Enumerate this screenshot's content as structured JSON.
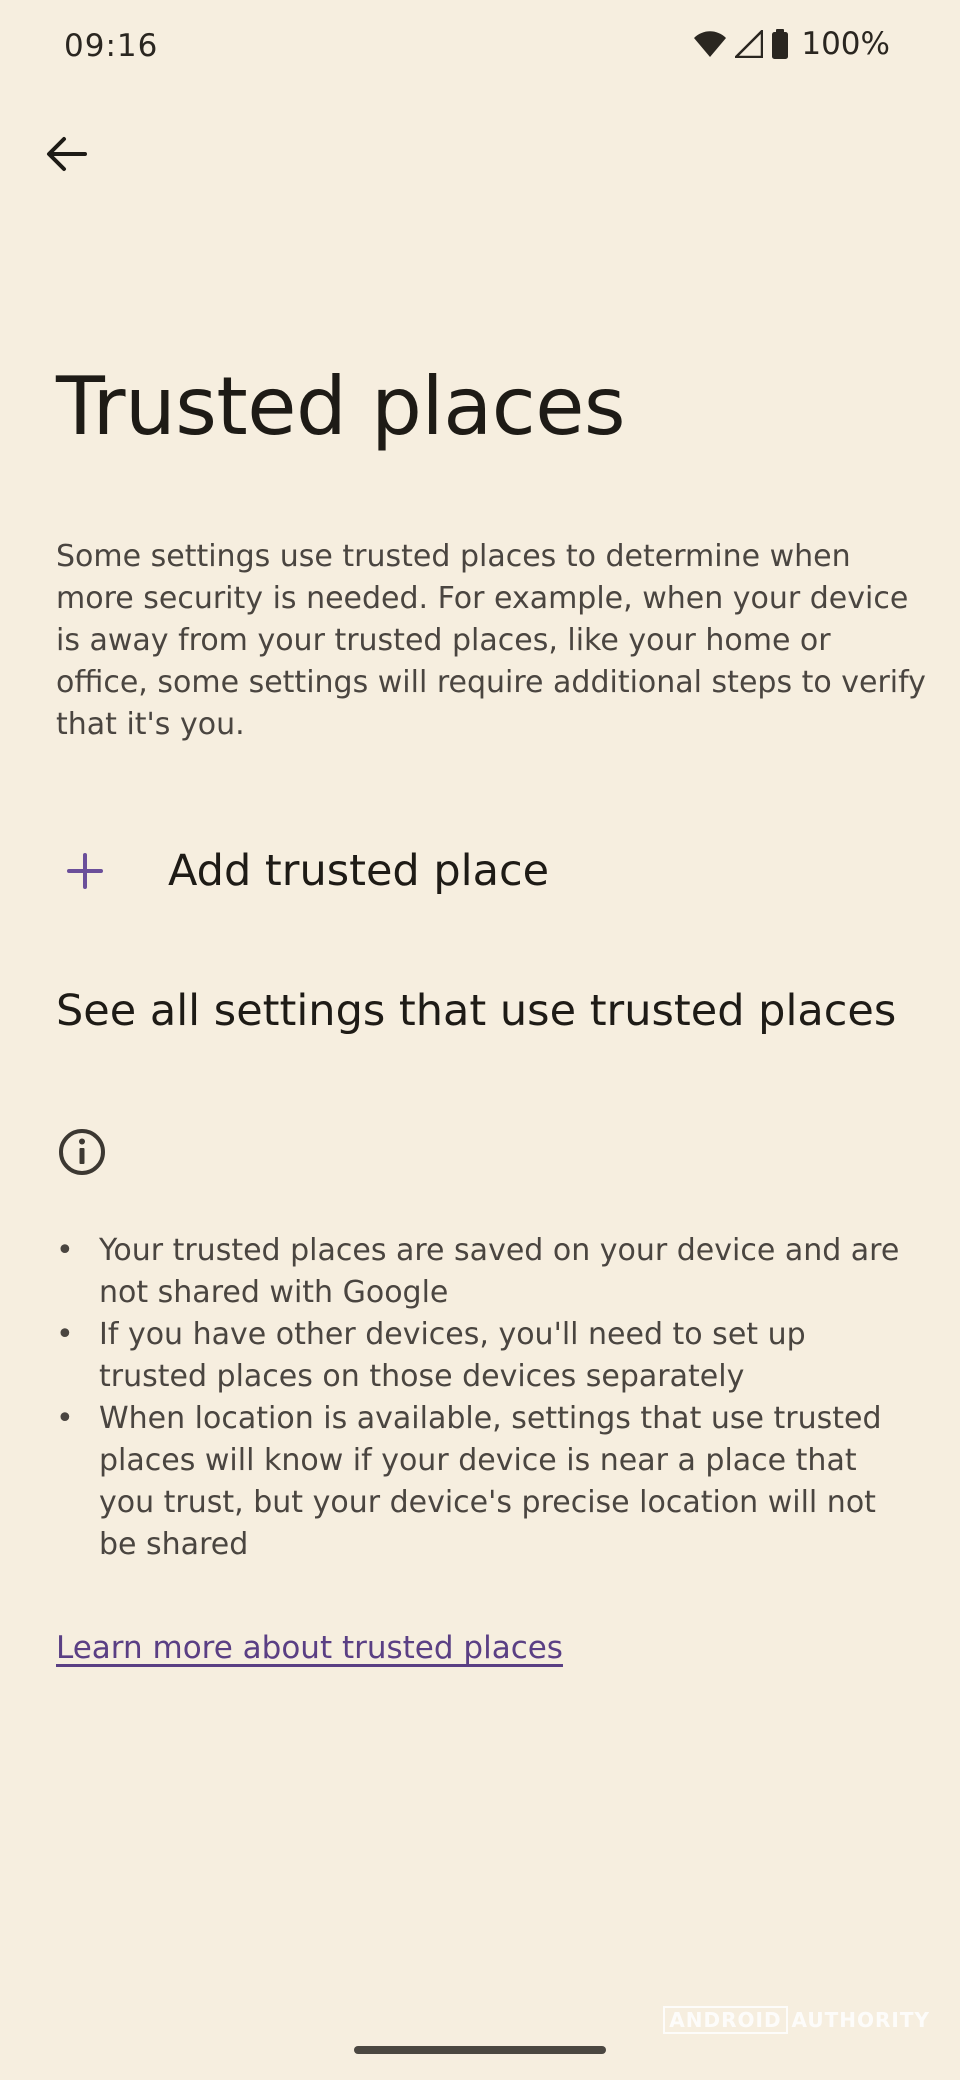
{
  "status_bar": {
    "time": "09:16",
    "battery": "100%",
    "icons": [
      "wifi-icon",
      "cell-signal-icon",
      "battery-icon"
    ]
  },
  "header": {
    "back_icon": "arrow-back-icon"
  },
  "page": {
    "title": "Trusted places",
    "description": "Some settings use trusted places to determine when more security is needed. For example, when your device is away from your trusted places, like your home or office, some settings will require additional steps to verify that it's you."
  },
  "actions": {
    "add_icon": "plus-icon",
    "add_label": "Add trusted place",
    "see_all_label": "See all settings that use trusted places"
  },
  "info": {
    "icon": "info-icon",
    "bullet_glyph": "•",
    "items": [
      "Your trusted places are saved on your device and are not shared with Google",
      "If you have other devices, you'll need to set up trusted places on those devices separately",
      "When location is available, settings that use trusted places will know if your device is near a place that you trust, but your device's precise location will not be shared"
    ]
  },
  "links": {
    "learn_more": "Learn more about trusted places"
  },
  "watermark": {
    "part1": "ANDROID",
    "part2": "AUTHORITY"
  },
  "colors": {
    "background": "#f6eedf",
    "text_primary": "#1e1b16",
    "text_secondary": "#4a4540",
    "accent": "#6b4f9a",
    "link": "#5a3f84"
  }
}
